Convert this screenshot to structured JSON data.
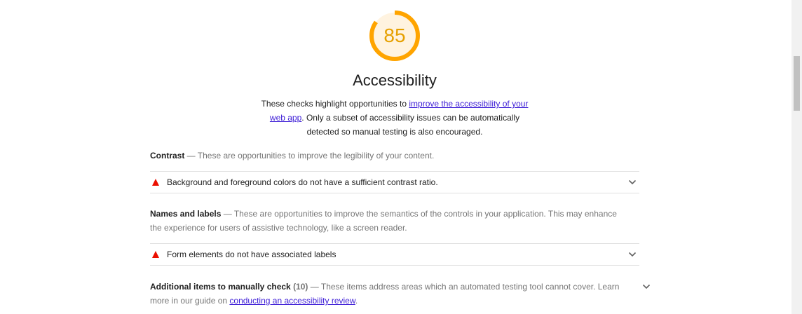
{
  "score": {
    "value": "85",
    "fraction": 0.85,
    "color": "#ffa400"
  },
  "category": {
    "title": "Accessibility",
    "desc_before": "These checks highlight opportunities to ",
    "desc_link": "improve the accessibility of your web app",
    "desc_after": ". Only a subset of accessibility issues can be automatically detected so manual testing is also encouraged."
  },
  "groups": [
    {
      "title": "Contrast",
      "sep": " — ",
      "desc": "These are opportunities to improve the legibility of your content.",
      "audit": "Background and foreground colors do not have a sufficient contrast ratio."
    },
    {
      "title": "Names and labels",
      "sep": " — ",
      "desc": "These are opportunities to improve the semantics of the controls in your application. This may enhance the experience for users of assistive technology, like a screen reader.",
      "audit": "Form elements do not have associated labels"
    }
  ],
  "manual": {
    "title": "Additional items to manually check",
    "count": "(10)",
    "sep": " — ",
    "desc": "These items address areas which an automated testing tool cannot cover. Learn more in our guide on ",
    "link": "conducting an accessibility review",
    "end": "."
  },
  "icons": {
    "fail": "fail-triangle-icon",
    "expand": "chevron-down-icon"
  },
  "colors": {
    "fail": "#eb0f00",
    "average": "#ffa400",
    "link": "#3c1cd6"
  }
}
